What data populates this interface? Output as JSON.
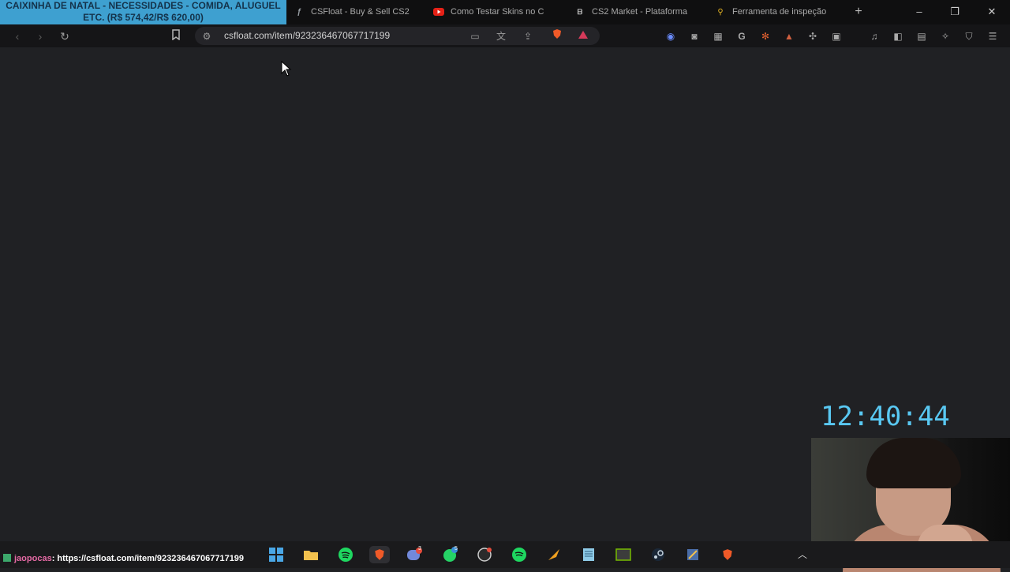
{
  "overlay": {
    "line1": "CAIXINHA DE NATAL - NECESSIDADES - COMIDA, ALUGUEL",
    "line2": "ETC. (R$ 574,42/R$ 620,00)"
  },
  "tabs": [
    {
      "title": "CSFloat - Buy & Sell CS2",
      "icon": "csfloat-icon"
    },
    {
      "title": "Como Testar Skins no C",
      "icon": "youtube-icon"
    },
    {
      "title": "CS2 Market - Plataforma",
      "icon": "cs2market-icon"
    },
    {
      "title": "Ferramenta de inspeção",
      "icon": "search-icon"
    }
  ],
  "toolbar": {
    "url": "csfloat.com/item/923236467067717199"
  },
  "clock": "12:40:44",
  "chat": {
    "user": "jaopocas",
    "message": ": https://csfloat.com/item/923236467067717199"
  },
  "badges": {
    "discord": "3",
    "whatsapp": "5"
  },
  "colors": {
    "overlay_bg": "#3ea0d0",
    "clock": "#59c8f2",
    "page_bg": "#202124"
  }
}
